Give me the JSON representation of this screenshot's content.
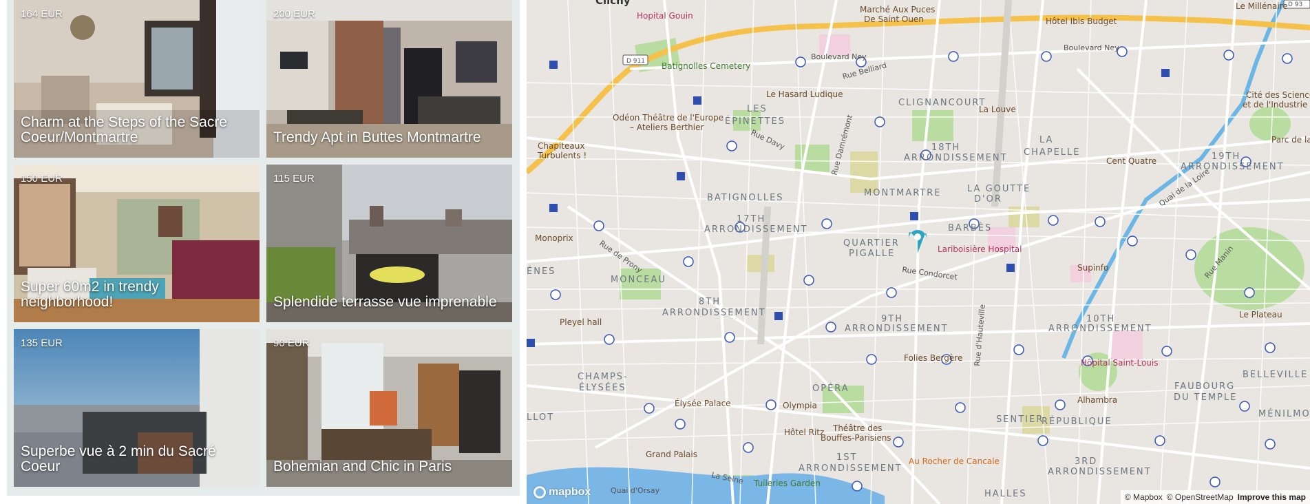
{
  "listings": [
    {
      "price": "164 EUR",
      "title": "Charm at the Steps of the Sacre Coeur/Montmartre"
    },
    {
      "price": "200 EUR",
      "title": "Trendy Apt in Buttes Montmartre"
    },
    {
      "price": "150 EUR",
      "title": "Super 60m2 in trendy neighborhood!"
    },
    {
      "price": "115 EUR",
      "title": "Splendide terrasse vue imprenable"
    },
    {
      "price": "135 EUR",
      "title": "Superbe vue à 2 min du Sacré Coeur"
    },
    {
      "price": "90 EUR",
      "title": "Bohemian and Chic in Paris"
    }
  ],
  "map": {
    "districts": [
      "LES",
      "ÉPINETTES",
      "CLIGNANCOURT",
      "18TH",
      "ARRONDISSEMENT",
      "LA",
      "CHAPELLE",
      "19TH",
      "ARRONDISSEMENT",
      "BATIGNOLLES",
      "MONTMARTRE",
      "LA GOUTTE",
      "D'OR",
      "17TH",
      "ARRONDISSEMENT",
      "QUARTIER",
      "PIGALLE",
      "BARBÈS",
      "MONCEAU",
      "8TH",
      "ARRONDISSEMENT",
      "9TH",
      "ARRONDISSEMENT",
      "10TH",
      "ARRONDISSEMENT",
      "CHAMPS-",
      "ÉLYSÉES",
      "OPÉRA",
      "SENTIER",
      "1ST",
      "ARRONDISSEMENT",
      "3RD",
      "ARRONDISSEMENT",
      "FAUBOURG",
      "DU TEMPLE",
      "BELLEVILLE",
      "MÉNILMONT",
      "HALLES",
      "RÉPUBLIQUE",
      "ÉNES",
      "LLOT"
    ],
    "streets": [
      "Boulevard Ney",
      "Boulevard Ney",
      "Rue Belliard",
      "Rue Davy",
      "Rue Damrémont",
      "Rue de Prony",
      "Rue Condorcet",
      "Rue d'Hauteville",
      "Quai de la Loire",
      "Rue Manin",
      "Quai d'Orsay",
      "La Seine",
      "D 911",
      "D 93"
    ],
    "pois": [
      "Clichy",
      "Marché Aux Puces",
      "De Saint Ouen",
      "Hôtel Ibis Budget",
      "Le Millénaire",
      "Batignolles Cemetery",
      "Le Hasard Ludique",
      "La Louve",
      "Odéon Théâtre de l'Europe",
      "– Ateliers Berthier",
      "Chapiteaux",
      "Turbulents !",
      "Cent Quatre",
      "Cité des Sciences",
      "et de l'Industrie",
      "Parc de la",
      "Monoprix",
      "Supinfo",
      "Pleyel hall",
      "Le Plateau",
      "Folies Bergère",
      "Alhambra",
      "Élysée Palace",
      "Olympia",
      "Théâtre des",
      "Bouffes-Parisiens",
      "Hôtel Ritz",
      "Grand Palais",
      "Tuileries Garden"
    ],
    "hospitals": [
      "Hopital Gouin",
      "Lariboisière Hospital",
      "Hôpital Saint-Louis"
    ],
    "restaurants": [
      "Au Rocher de Cancale"
    ],
    "attribution": {
      "mapbox": "© Mapbox",
      "osm": "© OpenStreetMap",
      "improve": "Improve this map"
    },
    "logo": "mapbox",
    "pin_color": "#2aa4c3"
  }
}
